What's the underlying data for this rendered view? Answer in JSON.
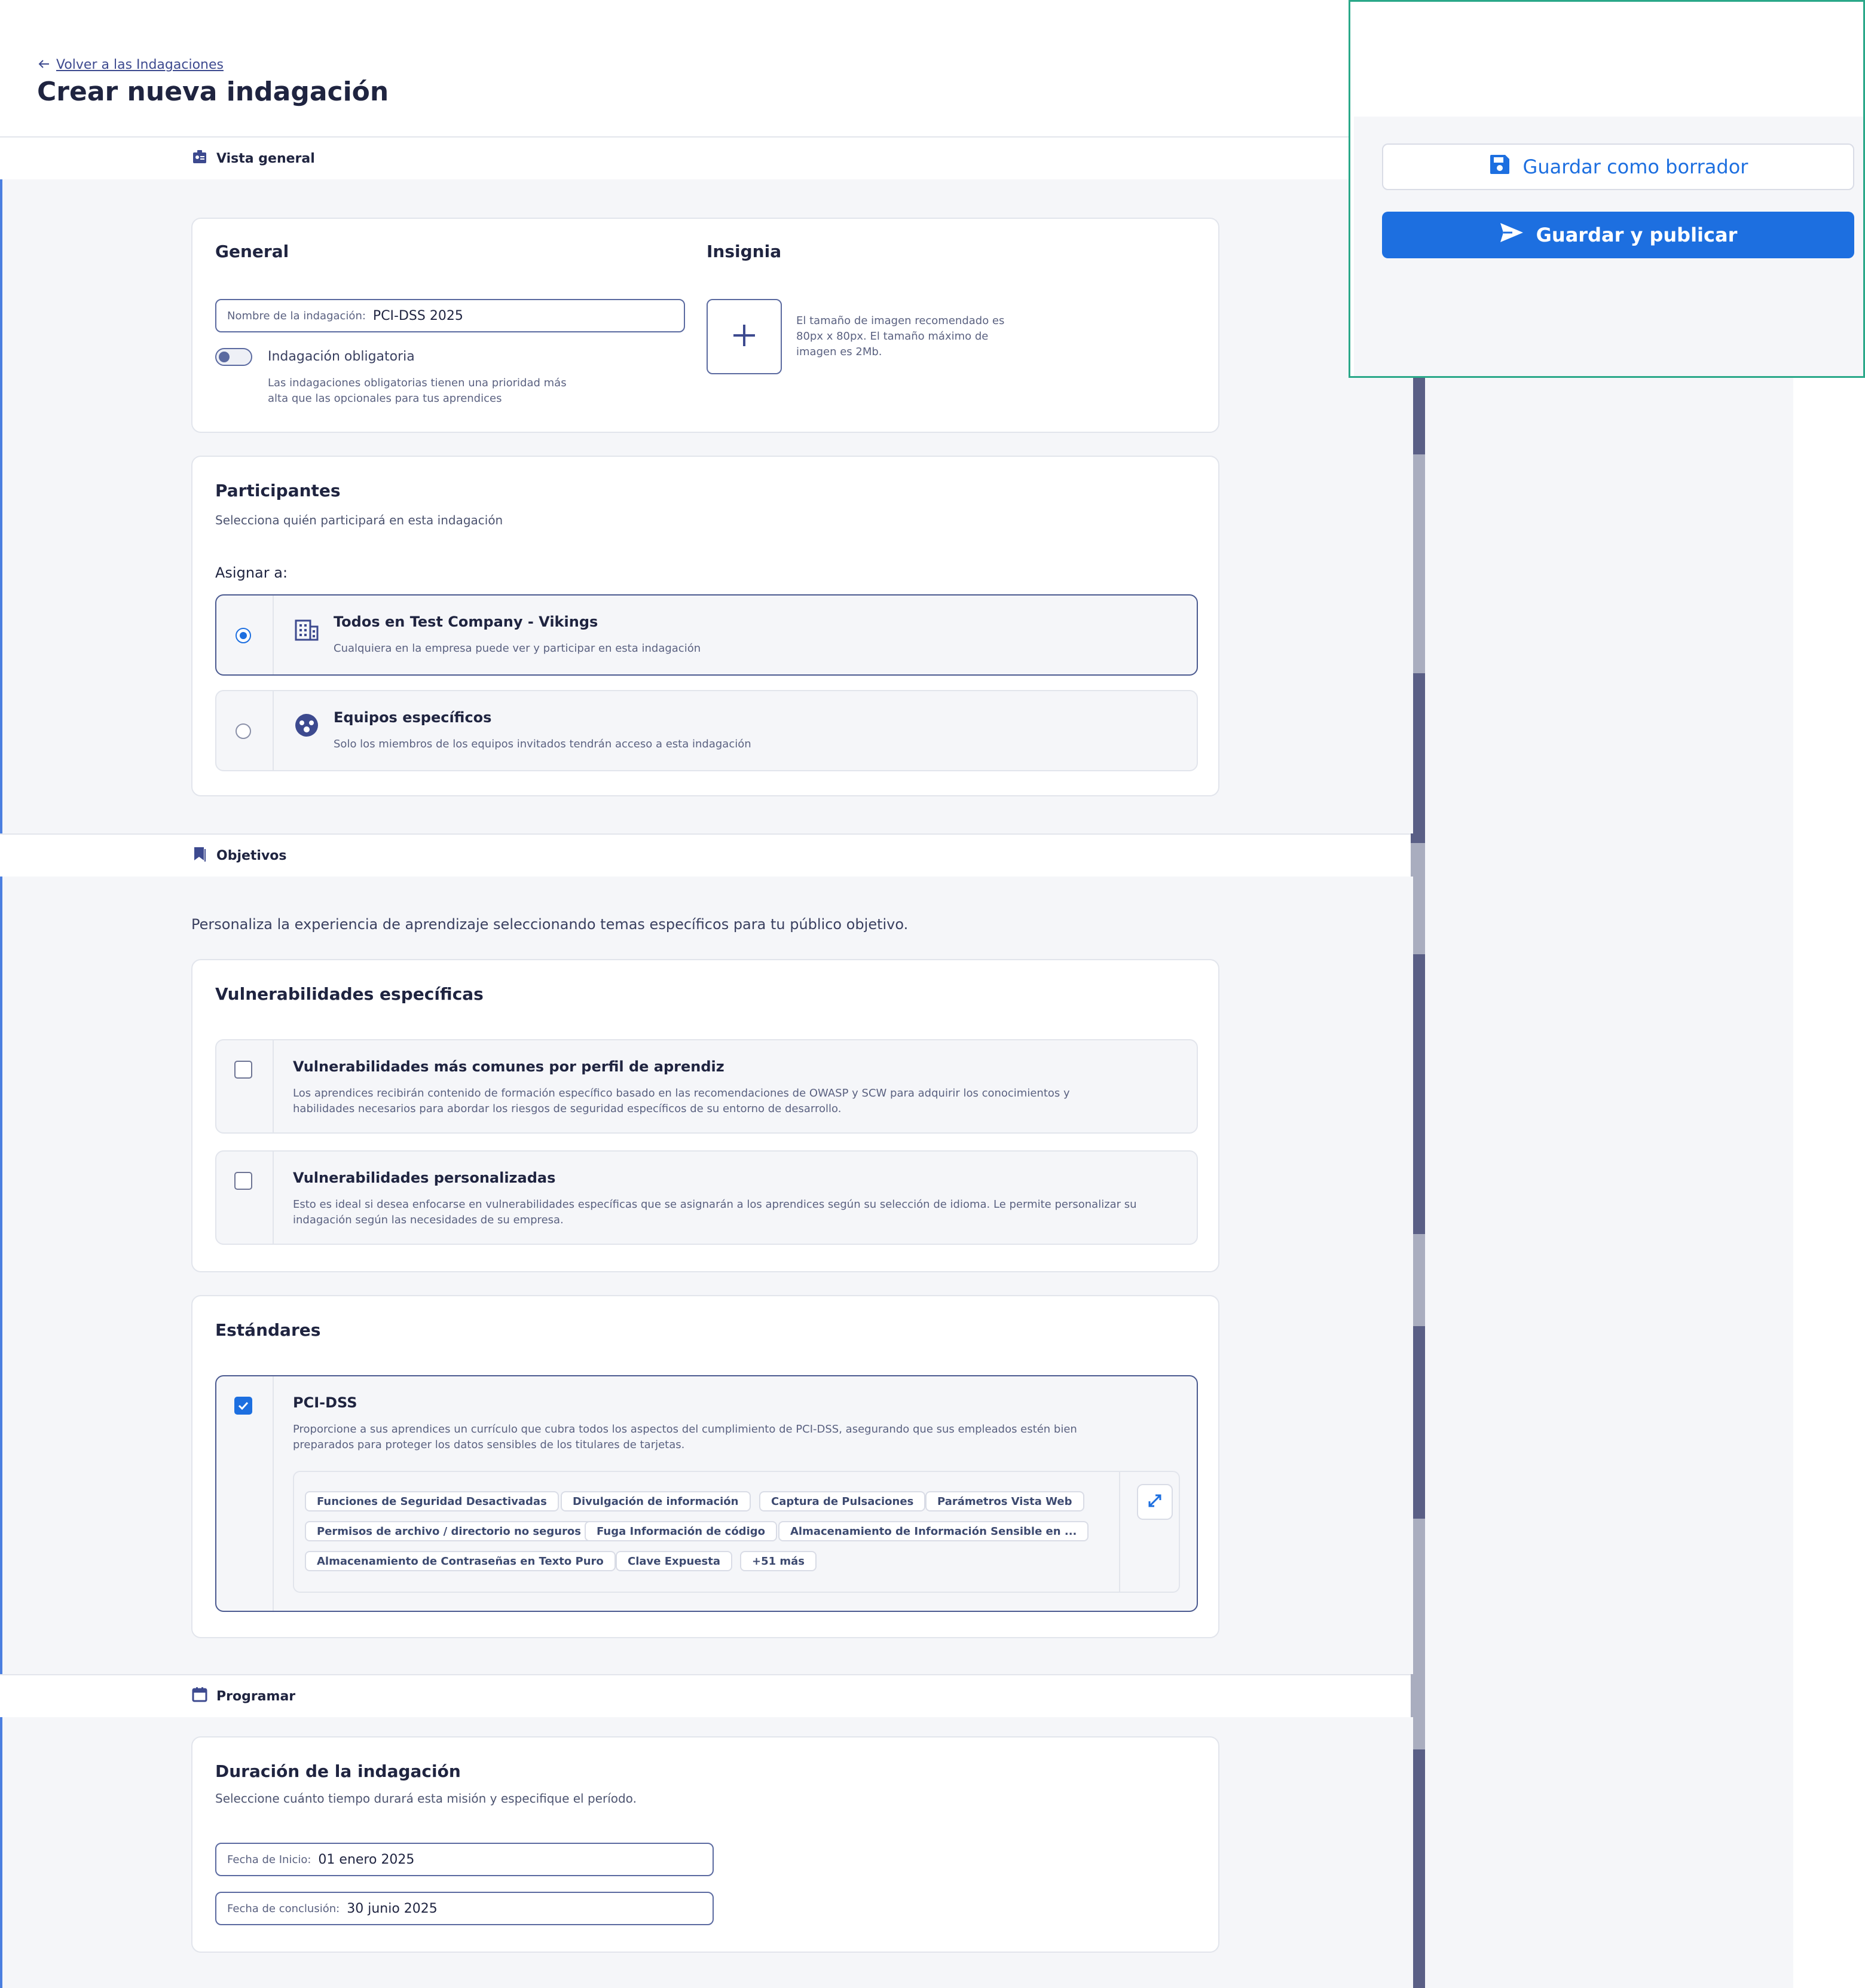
{
  "header": {
    "back_link": "Volver a las Indagaciones",
    "title": "Crear nueva indagación"
  },
  "sections": {
    "overview": "Vista general",
    "objectives": "Objetivos",
    "schedule": "Programar"
  },
  "general": {
    "title": "General",
    "name_label": "Nombre de la indagación:",
    "name_value": "PCI-DSS 2025",
    "toggle_label": "Indagación obligatoria",
    "toggle_on": false,
    "toggle_help_1": "Las indagaciones obligatorias tienen una prioridad más",
    "toggle_help_2": "alta que las opcionales para tus aprendices"
  },
  "badge": {
    "title": "Insignia",
    "help_1": "El tamaño de imagen recomendado es",
    "help_2": "80px x 80px. El tamaño máximo de",
    "help_3": "imagen es 2Mb."
  },
  "participants": {
    "title": "Participantes",
    "subtitle": "Selecciona quién participará en esta indagación",
    "assign_label": "Asignar a:",
    "options": [
      {
        "title": "Todos en Test Company - Vikings",
        "desc": "Cualquiera en la empresa puede ver y participar en esta indagación",
        "selected": true
      },
      {
        "title": "Equipos específicos",
        "desc": "Solo los miembros de los equipos invitados tendrán acceso a esta indagación",
        "selected": false
      }
    ]
  },
  "objectives": {
    "intro": "Personaliza la experiencia de aprendizaje seleccionando temas específicos para tu público objetivo.",
    "vuln_title": "Vulnerabilidades específicas",
    "vuln_options": [
      {
        "title": "Vulnerabilidades más comunes por perfil de aprendiz",
        "desc_1": "Los aprendices recibirán contenido de formación específico basado en las recomendaciones de OWASP y SCW para adquirir los conocimientos y",
        "desc_2": "habilidades necesarios para abordar los riesgos de seguridad específicos de su entorno de desarrollo.",
        "checked": false
      },
      {
        "title": "Vulnerabilidades personalizadas",
        "desc_1": "Esto es ideal si desea enfocarse en vulnerabilidades específicas que se asignarán a los aprendices según su selección de idioma. Le permite personalizar su",
        "desc_2": "indagación según las necesidades de su empresa.",
        "checked": false
      }
    ],
    "standards_title": "Estándares",
    "standard": {
      "title": "PCI-DSS",
      "checked": true,
      "desc_1": "Proporcione a sus aprendices un currículo que cubra todos los aspectos del cumplimiento de PCI-DSS, asegurando que sus empleados estén bien",
      "desc_2": "preparados para proteger los datos sensibles de los titulares de tarjetas.",
      "tags": [
        "Funciones de Seguridad Desactivadas",
        "Divulgación de información",
        "Captura de Pulsaciones",
        "Parámetros Vista Web",
        "Permisos de archivo / directorio no seguros",
        "Fuga Información de código",
        "Almacenamiento de Información Sensible en ...",
        "Almacenamiento de Contraseñas en Texto Puro",
        "Clave Expuesta",
        "+51 más"
      ]
    }
  },
  "schedule": {
    "title": "Duración de la indagación",
    "subtitle": "Seleccione cuánto tiempo durará esta misión y especifique el período.",
    "start_label": "Fecha de Inicio:",
    "start_value": "01 enero 2025",
    "end_label": "Fecha de conclusión:",
    "end_value": "30 junio 2025"
  },
  "actions": {
    "draft": "Guardar como borrador",
    "publish": "Guardar y publicar"
  },
  "colors": {
    "primary": "#1d6fe0",
    "panel_border": "#2aa889",
    "accent_line": "#4b7fe0"
  }
}
